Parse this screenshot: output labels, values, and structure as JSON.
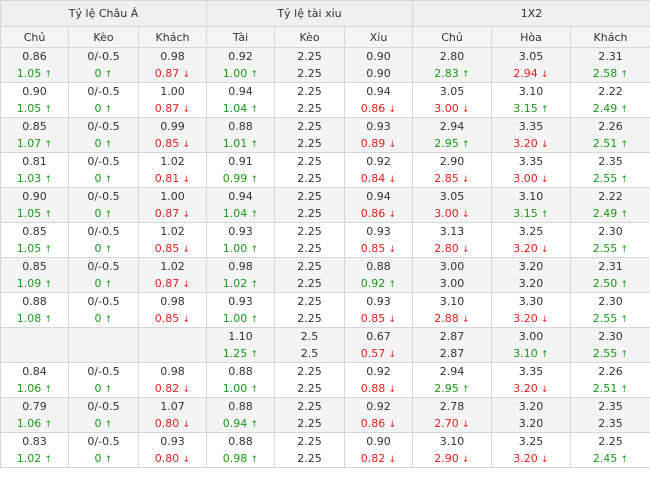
{
  "headers": {
    "groups": [
      "Tỷ lệ Châu Á",
      "Tỷ lệ tài xỉu",
      "1X2"
    ],
    "columns": [
      "Chủ",
      "Kèo",
      "Khách",
      "Tài",
      "Kèo",
      "Xỉu",
      "Chủ",
      "Hòa",
      "Khách"
    ]
  },
  "rows": [
    {
      "cells": [
        {
          "o": "0.86",
          "n": "1.05",
          "d": "up"
        },
        {
          "o": "0/-0.5",
          "n": "0",
          "d": "up"
        },
        {
          "o": "0.98",
          "n": "0.87",
          "d": "down"
        },
        {
          "o": "0.92",
          "n": "1.00",
          "d": "up"
        },
        {
          "o": "2.25",
          "n": "2.25",
          "d": ""
        },
        {
          "o": "0.90",
          "n": "0.90",
          "d": ""
        },
        {
          "o": "2.80",
          "n": "2.83",
          "d": "up"
        },
        {
          "o": "3.05",
          "n": "2.94",
          "d": "down"
        },
        {
          "o": "2.31",
          "n": "2.58",
          "d": "up"
        }
      ]
    },
    {
      "cells": [
        {
          "o": "0.90",
          "n": "1.05",
          "d": "up"
        },
        {
          "o": "0/-0.5",
          "n": "0",
          "d": "up"
        },
        {
          "o": "1.00",
          "n": "0.87",
          "d": "down"
        },
        {
          "o": "0.94",
          "n": "1.04",
          "d": "up"
        },
        {
          "o": "2.25",
          "n": "2.25",
          "d": ""
        },
        {
          "o": "0.94",
          "n": "0.86",
          "d": "down"
        },
        {
          "o": "3.05",
          "n": "3.00",
          "d": "down"
        },
        {
          "o": "3.10",
          "n": "3.15",
          "d": "up"
        },
        {
          "o": "2.22",
          "n": "2.49",
          "d": "up"
        }
      ]
    },
    {
      "cells": [
        {
          "o": "0.85",
          "n": "1.07",
          "d": "up"
        },
        {
          "o": "0/-0.5",
          "n": "0",
          "d": "up"
        },
        {
          "o": "0.99",
          "n": "0.85",
          "d": "down"
        },
        {
          "o": "0.88",
          "n": "1.01",
          "d": "up"
        },
        {
          "o": "2.25",
          "n": "2.25",
          "d": ""
        },
        {
          "o": "0.93",
          "n": "0.89",
          "d": "down"
        },
        {
          "o": "2.94",
          "n": "2.95",
          "d": "up"
        },
        {
          "o": "3.35",
          "n": "3.20",
          "d": "down"
        },
        {
          "o": "2.26",
          "n": "2.51",
          "d": "up"
        }
      ]
    },
    {
      "cells": [
        {
          "o": "0.81",
          "n": "1.03",
          "d": "up"
        },
        {
          "o": "0/-0.5",
          "n": "0",
          "d": "up"
        },
        {
          "o": "1.02",
          "n": "0.81",
          "d": "down"
        },
        {
          "o": "0.91",
          "n": "0.99",
          "d": "up"
        },
        {
          "o": "2.25",
          "n": "2.25",
          "d": ""
        },
        {
          "o": "0.92",
          "n": "0.84",
          "d": "down"
        },
        {
          "o": "2.90",
          "n": "2.85",
          "d": "down"
        },
        {
          "o": "3.35",
          "n": "3.00",
          "d": "down"
        },
        {
          "o": "2.35",
          "n": "2.55",
          "d": "up"
        }
      ]
    },
    {
      "cells": [
        {
          "o": "0.90",
          "n": "1.05",
          "d": "up"
        },
        {
          "o": "0/-0.5",
          "n": "0",
          "d": "up"
        },
        {
          "o": "1.00",
          "n": "0.87",
          "d": "down"
        },
        {
          "o": "0.94",
          "n": "1.04",
          "d": "up"
        },
        {
          "o": "2.25",
          "n": "2.25",
          "d": ""
        },
        {
          "o": "0.94",
          "n": "0.86",
          "d": "down"
        },
        {
          "o": "3.05",
          "n": "3.00",
          "d": "down"
        },
        {
          "o": "3.10",
          "n": "3.15",
          "d": "up"
        },
        {
          "o": "2.22",
          "n": "2.49",
          "d": "up"
        }
      ]
    },
    {
      "cells": [
        {
          "o": "0.85",
          "n": "1.05",
          "d": "up"
        },
        {
          "o": "0/-0.5",
          "n": "0",
          "d": "up"
        },
        {
          "o": "1.02",
          "n": "0.85",
          "d": "down"
        },
        {
          "o": "0.93",
          "n": "1.00",
          "d": "up"
        },
        {
          "o": "2.25",
          "n": "2.25",
          "d": ""
        },
        {
          "o": "0.93",
          "n": "0.85",
          "d": "down"
        },
        {
          "o": "3.13",
          "n": "2.80",
          "d": "down"
        },
        {
          "o": "3.25",
          "n": "3.20",
          "d": "down"
        },
        {
          "o": "2.30",
          "n": "2.55",
          "d": "up"
        }
      ]
    },
    {
      "cells": [
        {
          "o": "0.85",
          "n": "1.09",
          "d": "up"
        },
        {
          "o": "0/-0.5",
          "n": "0",
          "d": "up"
        },
        {
          "o": "1.02",
          "n": "0.87",
          "d": "down"
        },
        {
          "o": "0.98",
          "n": "1.02",
          "d": "up"
        },
        {
          "o": "2.25",
          "n": "2.25",
          "d": ""
        },
        {
          "o": "0.88",
          "n": "0.92",
          "d": "up"
        },
        {
          "o": "3.00",
          "n": "3.00",
          "d": ""
        },
        {
          "o": "3.20",
          "n": "3.20",
          "d": ""
        },
        {
          "o": "2.31",
          "n": "2.50",
          "d": "up"
        }
      ]
    },
    {
      "cells": [
        {
          "o": "0.88",
          "n": "1.08",
          "d": "up"
        },
        {
          "o": "0/-0.5",
          "n": "0",
          "d": "up"
        },
        {
          "o": "0.98",
          "n": "0.85",
          "d": "down"
        },
        {
          "o": "0.93",
          "n": "1.00",
          "d": "up"
        },
        {
          "o": "2.25",
          "n": "2.25",
          "d": ""
        },
        {
          "o": "0.93",
          "n": "0.85",
          "d": "down"
        },
        {
          "o": "3.10",
          "n": "2.88",
          "d": "down"
        },
        {
          "o": "3.30",
          "n": "3.20",
          "d": "down"
        },
        {
          "o": "2.30",
          "n": "2.55",
          "d": "up"
        }
      ]
    },
    {
      "cells": [
        {
          "o": "",
          "n": "",
          "d": ""
        },
        {
          "o": "",
          "n": "",
          "d": ""
        },
        {
          "o": "",
          "n": "",
          "d": ""
        },
        {
          "o": "1.10",
          "n": "1.25",
          "d": "up"
        },
        {
          "o": "2.5",
          "n": "2.5",
          "d": ""
        },
        {
          "o": "0.67",
          "n": "0.57",
          "d": "down"
        },
        {
          "o": "2.87",
          "n": "2.87",
          "d": ""
        },
        {
          "o": "3.00",
          "n": "3.10",
          "d": "up"
        },
        {
          "o": "2.30",
          "n": "2.55",
          "d": "up"
        }
      ]
    },
    {
      "cells": [
        {
          "o": "0.84",
          "n": "1.06",
          "d": "up"
        },
        {
          "o": "0/-0.5",
          "n": "0",
          "d": "up"
        },
        {
          "o": "0.98",
          "n": "0.82",
          "d": "down"
        },
        {
          "o": "0.88",
          "n": "1.00",
          "d": "up"
        },
        {
          "o": "2.25",
          "n": "2.25",
          "d": ""
        },
        {
          "o": "0.92",
          "n": "0.88",
          "d": "down"
        },
        {
          "o": "2.94",
          "n": "2.95",
          "d": "up"
        },
        {
          "o": "3.35",
          "n": "3.20",
          "d": "down"
        },
        {
          "o": "2.26",
          "n": "2.51",
          "d": "up"
        }
      ]
    },
    {
      "cells": [
        {
          "o": "0.79",
          "n": "1.06",
          "d": "up"
        },
        {
          "o": "0/-0.5",
          "n": "0",
          "d": "up"
        },
        {
          "o": "1.07",
          "n": "0.80",
          "d": "down"
        },
        {
          "o": "0.88",
          "n": "0.94",
          "d": "up"
        },
        {
          "o": "2.25",
          "n": "2.25",
          "d": ""
        },
        {
          "o": "0.92",
          "n": "0.86",
          "d": "down"
        },
        {
          "o": "2.78",
          "n": "2.70",
          "d": "down"
        },
        {
          "o": "3.20",
          "n": "3.20",
          "d": ""
        },
        {
          "o": "2.35",
          "n": "2.35",
          "d": ""
        }
      ]
    },
    {
      "cells": [
        {
          "o": "0.83",
          "n": "1.02",
          "d": "up"
        },
        {
          "o": "0/-0.5",
          "n": "0",
          "d": "up"
        },
        {
          "o": "0.93",
          "n": "0.80",
          "d": "down"
        },
        {
          "o": "0.88",
          "n": "0.98",
          "d": "up"
        },
        {
          "o": "2.25",
          "n": "2.25",
          "d": ""
        },
        {
          "o": "0.90",
          "n": "0.82",
          "d": "down"
        },
        {
          "o": "3.10",
          "n": "2.90",
          "d": "down"
        },
        {
          "o": "3.25",
          "n": "3.20",
          "d": "down"
        },
        {
          "o": "2.25",
          "n": "2.45",
          "d": "up"
        }
      ]
    }
  ]
}
